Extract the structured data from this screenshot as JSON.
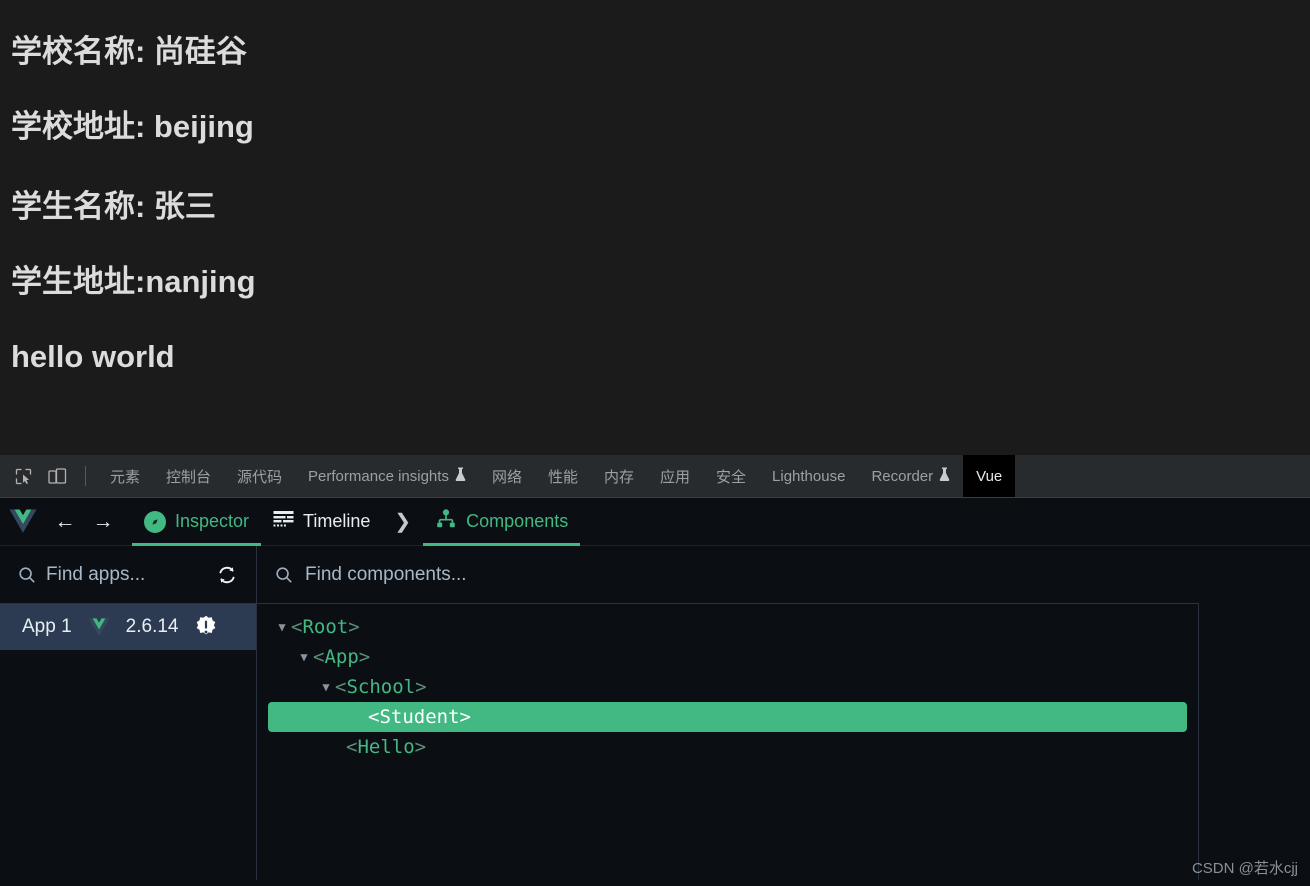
{
  "page": {
    "lines": [
      "学校名称: 尚硅谷",
      "学校地址: beijing",
      "学生名称: 张三",
      "学生地址:nanjing",
      "hello world"
    ]
  },
  "devtools": {
    "toolbar_icons": [
      {
        "name": "inspect-element-icon",
        "glyph": "inspect"
      },
      {
        "name": "device-toolbar-icon",
        "glyph": "device"
      }
    ],
    "tabs": [
      {
        "label": "元素",
        "active": false,
        "experimental": false
      },
      {
        "label": "控制台",
        "active": false,
        "experimental": false
      },
      {
        "label": "源代码",
        "active": false,
        "experimental": false
      },
      {
        "label": "Performance insights",
        "active": false,
        "experimental": true
      },
      {
        "label": "网络",
        "active": false,
        "experimental": false
      },
      {
        "label": "性能",
        "active": false,
        "experimental": false
      },
      {
        "label": "内存",
        "active": false,
        "experimental": false
      },
      {
        "label": "应用",
        "active": false,
        "experimental": false
      },
      {
        "label": "安全",
        "active": false,
        "experimental": false
      },
      {
        "label": "Lighthouse",
        "active": false,
        "experimental": false
      },
      {
        "label": "Recorder",
        "active": false,
        "experimental": true
      },
      {
        "label": "Vue",
        "active": true,
        "experimental": false
      }
    ],
    "experimental_glyph": "⚗"
  },
  "vue_toolbar": {
    "logo": "vue-logo",
    "back_label": "←",
    "forward_label": "→",
    "items": [
      {
        "label": "Inspector",
        "icon": "compass-icon",
        "active": true
      },
      {
        "label": "Timeline",
        "icon": "timeline-icon",
        "active": false
      }
    ],
    "chevron": "❯",
    "components_tab": {
      "label": "Components",
      "icon": "sitemap-icon",
      "active": true
    }
  },
  "apps_panel": {
    "search": {
      "placeholder": "Find apps...",
      "value": "",
      "icon": "search-icon"
    },
    "refresh_icon": "refresh-icon",
    "apps": [
      {
        "name": "App 1",
        "version": "2.6.14",
        "badge": "warning-badge",
        "selected": true
      }
    ]
  },
  "components_panel": {
    "search": {
      "placeholder": "Find components...",
      "value": "",
      "icon": "search-icon"
    },
    "tree": [
      {
        "label": "Root",
        "depth": 0,
        "expanded": true,
        "has_caret": true,
        "selected": false
      },
      {
        "label": "App",
        "depth": 1,
        "expanded": true,
        "has_caret": true,
        "selected": false
      },
      {
        "label": "School",
        "depth": 2,
        "expanded": true,
        "has_caret": true,
        "selected": false
      },
      {
        "label": "Student",
        "depth": 3,
        "expanded": false,
        "has_caret": false,
        "selected": true
      },
      {
        "label": "Hello",
        "depth": 2,
        "expanded": false,
        "has_caret": false,
        "selected": false
      }
    ]
  },
  "watermark": "CSDN @若水cjj",
  "colors": {
    "vue_green": "#42b883",
    "page_bg": "#1b1b1b",
    "devtools_bg": "#0b0f14",
    "tabbar_bg": "#282b2e",
    "app_selected_bg": "#2d3b52"
  }
}
